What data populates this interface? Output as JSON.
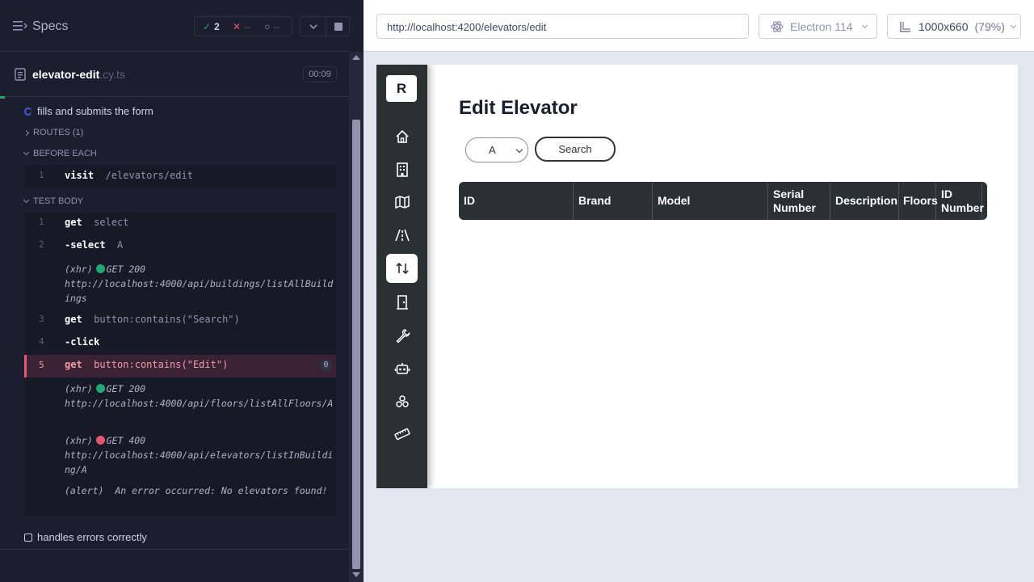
{
  "runner": {
    "specs_label": "Specs",
    "stats": {
      "passed": "2",
      "failed": "--",
      "pending": "--"
    },
    "file": {
      "name": "elevator-edit",
      "ext": ".cy.ts",
      "duration": "00:09"
    },
    "test1": {
      "title": "fills and submits the form",
      "routes_label": "ROUTES (1)",
      "before_each_label": "BEFORE EACH",
      "before_each_cmds": [
        {
          "num": "1",
          "name": "visit",
          "msg": "/elevators/edit"
        }
      ],
      "test_body_label": "TEST BODY",
      "cmds": [
        {
          "num": "1",
          "name": "get",
          "msg": "select"
        },
        {
          "num": "2",
          "name": "-select",
          "msg": "A"
        },
        {
          "num": "3",
          "name": "get",
          "msg": "button:contains(\"Search\")"
        },
        {
          "num": "4",
          "name": "-click",
          "msg": ""
        },
        {
          "num": "5",
          "name": "get",
          "msg": "button:contains(\"Edit\")",
          "badge": "0"
        }
      ],
      "xhr1": {
        "type": "(xhr)",
        "req": "GET 200",
        "url": "http://localhost:4000/api/buildings/listAllBuildings"
      },
      "xhr2": {
        "type": "(xhr)",
        "req": "GET 200",
        "url": "http://localhost:4000/api/floors/listAllFloors/A"
      },
      "xhr3": {
        "type": "(xhr)",
        "req": "GET 400",
        "url": "http://localhost:4000/api/elevators/listInBuilding/A"
      },
      "alert": {
        "type": "(alert)",
        "msg": "An error occurred: No elevators found!"
      }
    },
    "test2": {
      "title": "handles errors correctly"
    }
  },
  "browserbar": {
    "url": "http://localhost:4200/elevators/edit",
    "browser": "Electron 114",
    "viewport": "1000x660",
    "zoom": "(79%)"
  },
  "app": {
    "logo": "R",
    "title": "Edit Elevator",
    "select_value": "A",
    "search_label": "Search",
    "table_headers": [
      "ID",
      "Brand",
      "Model",
      "Serial Number",
      "Description",
      "Floors",
      "ID Number"
    ]
  },
  "colors": {
    "runner_bg": "#1b1e2e",
    "pass": "#1fa971",
    "fail": "#e45770",
    "app_sidebar": "#2a3133"
  },
  "icons": [
    "menu-icon",
    "file-icon",
    "home-icon",
    "building-icon",
    "map-icon",
    "road-icon",
    "elevator-icon",
    "door-icon",
    "wrench-icon",
    "robot-icon",
    "boxes-icon",
    "ruler-icon"
  ]
}
